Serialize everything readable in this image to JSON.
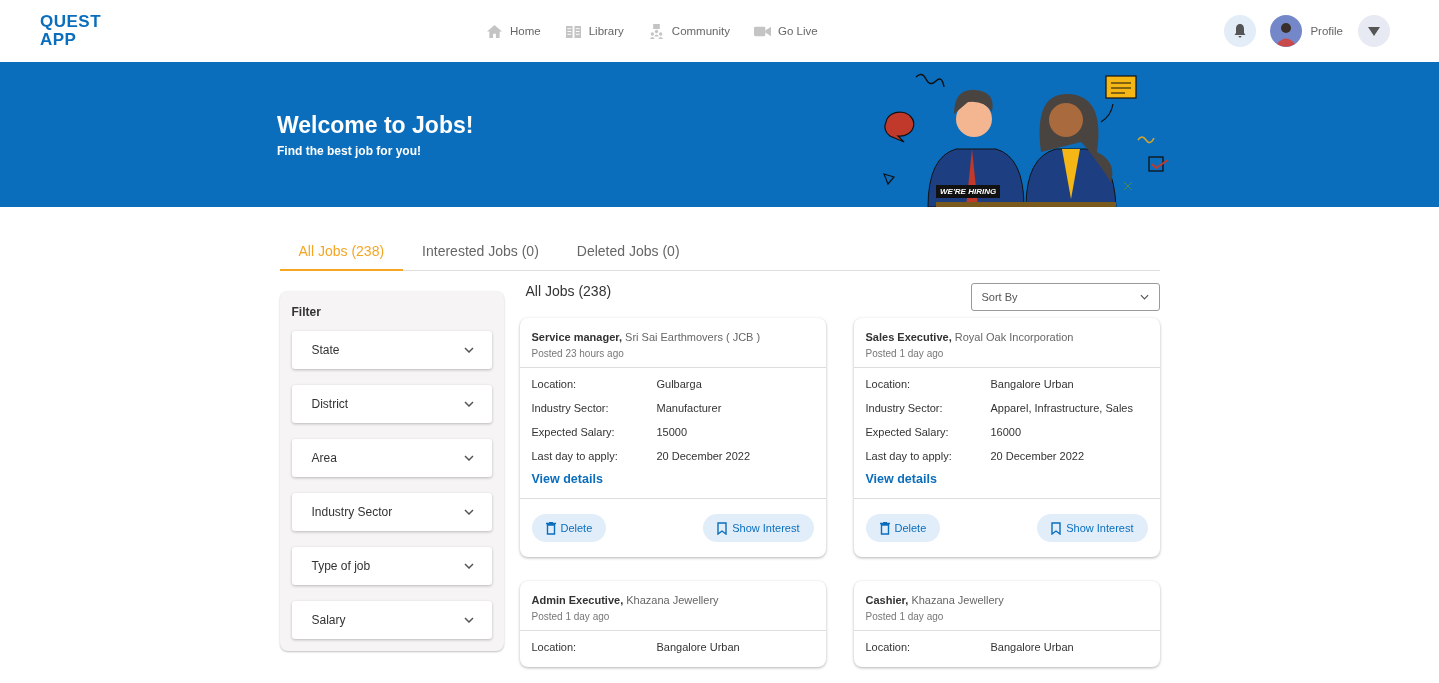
{
  "header": {
    "logo": [
      "QUEST",
      "APP"
    ],
    "nav": [
      {
        "label": "Home"
      },
      {
        "label": "Library"
      },
      {
        "label": "Community"
      },
      {
        "label": "Go Live"
      }
    ],
    "profile": {
      "label": "Profile"
    }
  },
  "banner": {
    "title": "Welcome to Jobs!",
    "subtitle": "Find the best job for you!",
    "sign": "WE'RE HIRING"
  },
  "tabs": [
    {
      "label": "All Jobs (238)",
      "selected": true
    },
    {
      "label": "Interested Jobs (0)",
      "selected": false
    },
    {
      "label": "Deleted Jobs (0)",
      "selected": false
    }
  ],
  "filter": {
    "title": "Filter",
    "items": [
      "State",
      "District",
      "Area",
      "Industry Sector",
      "Type of job",
      "Salary"
    ]
  },
  "list_title": "All Jobs (238)",
  "sort": {
    "placeholder": "Sort By"
  },
  "jobs": [
    {
      "title": "Service manager,",
      "company": "Sri Sai Earthmovers ( JCB )",
      "posted": "Posted 23 hours ago",
      "fields": [
        {
          "label": "Location:",
          "value": "Gulbarga"
        },
        {
          "label": "Industry Sector:",
          "value": "Manufacturer"
        },
        {
          "label": "Expected Salary:",
          "value": "15000"
        },
        {
          "label": "Last day to apply:",
          "value": "20 December 2022"
        }
      ],
      "link": "View details",
      "actions": [
        "Delete",
        "Show Interest"
      ]
    },
    {
      "title": "Sales Executive,",
      "company": "Royal Oak Incorporation",
      "posted": "Posted 1 day ago",
      "fields": [
        {
          "label": "Location:",
          "value": "Bangalore Urban"
        },
        {
          "label": "Industry Sector:",
          "value": "Apparel, Infrastructure, Sales"
        },
        {
          "label": "Expected Salary:",
          "value": "16000"
        },
        {
          "label": "Last day to apply:",
          "value": "20 December 2022"
        }
      ],
      "link": "View details",
      "actions": [
        "Delete",
        "Show Interest"
      ]
    },
    {
      "title": "Admin Executive,",
      "company": "Khazana Jewellery",
      "posted": "Posted 1 day ago",
      "fields": [
        {
          "label": "Location:",
          "value": "Bangalore Urban"
        }
      ]
    },
    {
      "title": "Cashier,",
      "company": "Khazana Jewellery",
      "posted": "Posted 1 day ago",
      "fields": [
        {
          "label": "Location:",
          "value": "Bangalore Urban"
        }
      ]
    }
  ]
}
